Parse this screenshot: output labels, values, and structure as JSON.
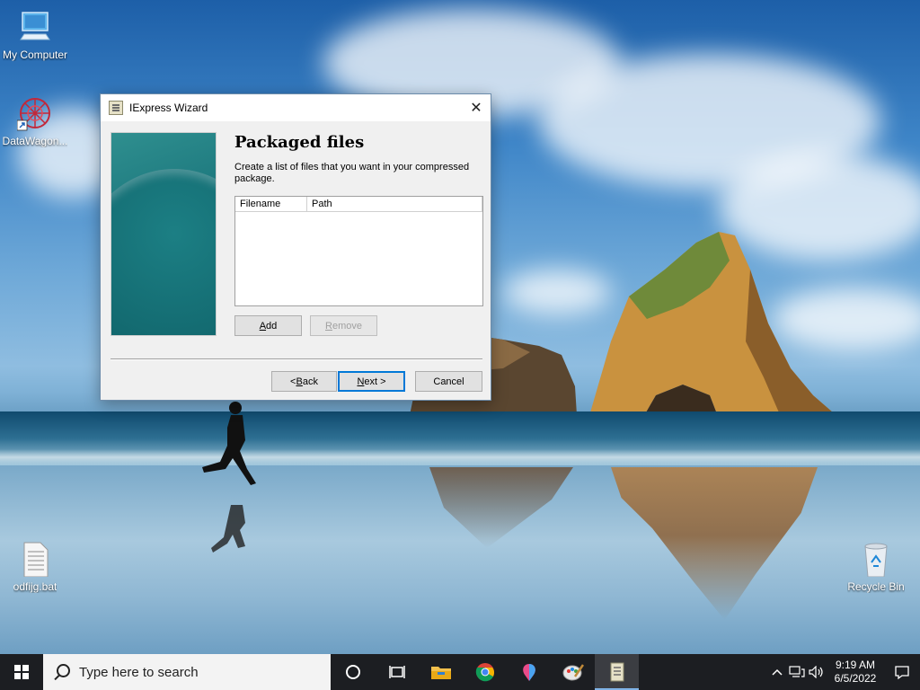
{
  "desktop": {
    "icons": [
      {
        "label": "My Computer",
        "icon": "monitor-icon"
      },
      {
        "label": "DataWagon...",
        "icon": "datawagon-app-icon"
      },
      {
        "label": "odfijg.bat",
        "icon": "batch-file-icon"
      },
      {
        "label": "Recycle Bin",
        "icon": "recycle-bin-icon"
      }
    ]
  },
  "dialog": {
    "title": "IExpress Wizard",
    "close_glyph": "✕",
    "heading": "Packaged files",
    "description": "Create a list of files that you want in your compressed package.",
    "list": {
      "columns": [
        "Filename",
        "Path"
      ],
      "rows": []
    },
    "buttons": {
      "add": {
        "prefix": "",
        "underline": "A",
        "suffix": "dd"
      },
      "remove": {
        "prefix": "",
        "underline": "R",
        "suffix": "emove",
        "disabled": true
      },
      "back": {
        "prefix": "< ",
        "underline": "B",
        "suffix": "ack"
      },
      "next": {
        "prefix": "",
        "underline": "N",
        "suffix": "ext >"
      },
      "cancel": "Cancel"
    }
  },
  "taskbar": {
    "search_placeholder": "Type here to search",
    "pinned": [
      "cortana-icon",
      "task-view-icon",
      "file-explorer-icon",
      "chrome-icon",
      "paint-3d-icon",
      "paint-icon",
      "iexpress-icon"
    ],
    "active_item": "iexpress-icon",
    "clock": {
      "time": "9:19 AM",
      "date": "6/5/2022"
    },
    "tray": [
      "chevron-up-icon",
      "network-icon",
      "volume-icon"
    ]
  }
}
